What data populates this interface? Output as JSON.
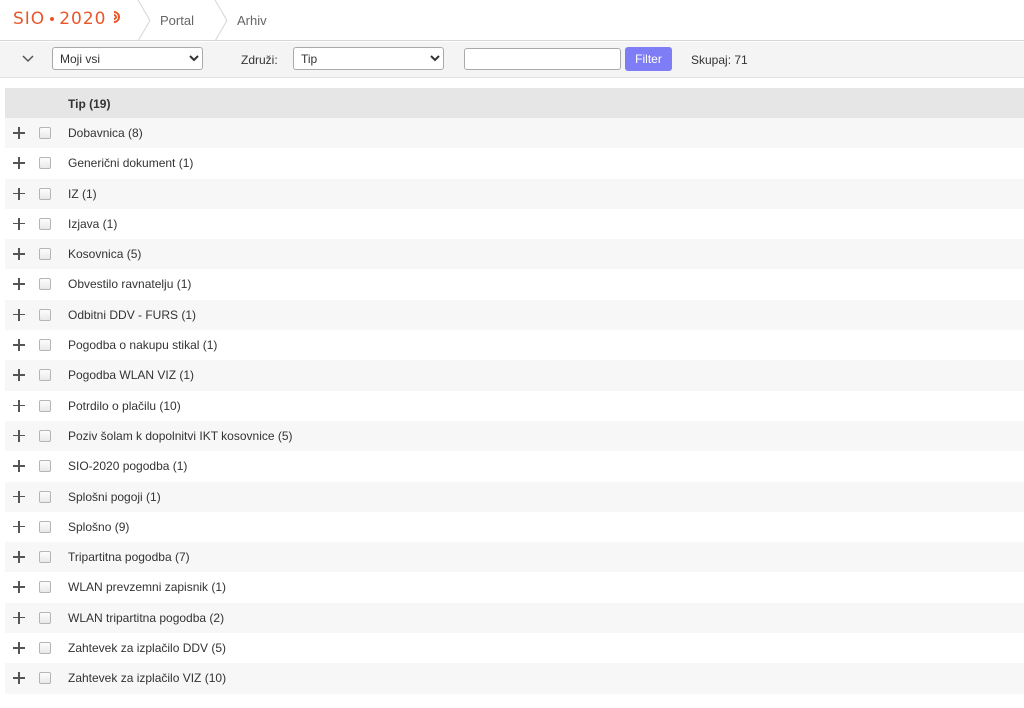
{
  "header": {
    "logo_text_left": "SIO",
    "logo_text_right": "2020",
    "breadcrumbs": [
      "Portal",
      "Arhiv"
    ]
  },
  "toolbar": {
    "scope_select": {
      "value": "Moji vsi",
      "options": [
        "Moji vsi"
      ]
    },
    "group_label": "Združi:",
    "group_select": {
      "value": "Tip",
      "options": [
        "Tip"
      ]
    },
    "filter_input_value": "",
    "filter_button_label": "Filter",
    "total_label": "Skupaj: 71"
  },
  "table": {
    "header_label": "Tip (19)",
    "rows": [
      "Dobavnica (8)",
      "Generični dokument (1)",
      "IZ (1)",
      "Izjava (1)",
      "Kosovnica (5)",
      "Obvestilo ravnatelju (1)",
      "Odbitni DDV - FURS (1)",
      "Pogodba o nakupu stikal (1)",
      "Pogodba WLAN VIZ (1)",
      "Potrdilo o plačilu (10)",
      "Poziv šolam k dopolnitvi IKT kosovnice (5)",
      "SIO-2020 pogodba (1)",
      "Splošni pogoji (1)",
      "Splošno (9)",
      "Tripartitna pogodba (7)",
      "WLAN prevzemni zapisnik (1)",
      "WLAN tripartitna pogodba (2)",
      "Zahtevek za izplačilo DDV (5)",
      "Zahtevek za izplačilo VIZ (10)"
    ]
  },
  "colors": {
    "brand": "#e8572a",
    "filter_button": "#7f7df5",
    "header_row": "#e6e6e6",
    "stripe": "#f7f7f7"
  }
}
